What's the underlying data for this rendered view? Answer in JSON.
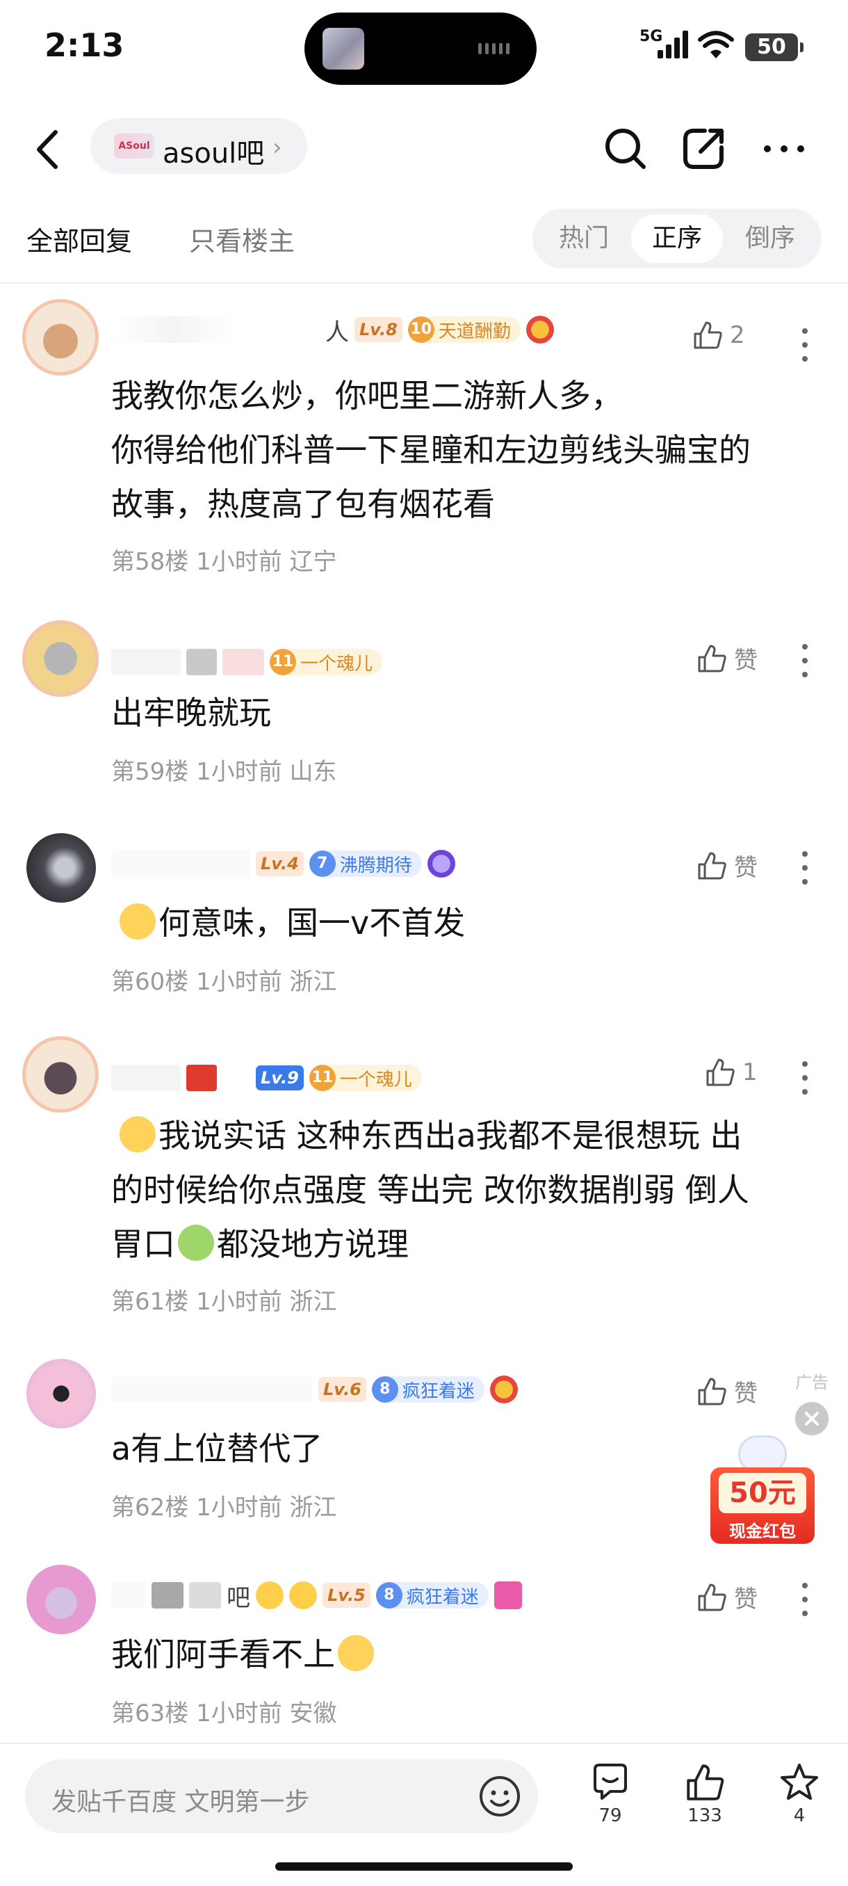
{
  "status_bar": {
    "time": "2:13",
    "network": "5G",
    "battery": "50"
  },
  "navbar": {
    "forum_logo_text": "ASoul",
    "forum_name": "asoul吧"
  },
  "tabs": {
    "all": "全部回复",
    "owner_only": "只看楼主"
  },
  "sort": {
    "hot": "热门",
    "asc": "正序",
    "desc": "倒序",
    "selected": "正序"
  },
  "posts": [
    {
      "name_fragment": "人",
      "level": "Lv.8",
      "badge_num": "10",
      "badge_text": "天道酬勤",
      "likes": "2",
      "content": [
        "我教你怎么炒，你吧里二游新人多，",
        "你得给他们科普一下星瞳和左边剪线头骗宝的",
        "故事，热度高了包有烟花看"
      ],
      "meta": "第58楼 1小时前 辽宁"
    },
    {
      "badge_num": "11",
      "badge_text": "一个魂儿",
      "likes": "赞",
      "content": [
        "出牢晚就玩"
      ],
      "meta": "第59楼 1小时前 山东"
    },
    {
      "level": "Lv.4",
      "badge_num": "7",
      "badge_text": "沸腾期待",
      "likes": "赞",
      "content": [
        "何意味，国一v不首发"
      ],
      "meta": "第60楼 1小时前 浙江"
    },
    {
      "level": "Lv.9",
      "badge_num": "11",
      "badge_text": "一个魂儿",
      "likes": "1",
      "content_line1": "我说实话 这种东西出a我都不是很想玩 出",
      "content_line2": "的时候给你点强度 等出完 改你数据削弱 倒人",
      "content_line3a": "胃口",
      "content_line3b": "都没地方说理",
      "meta": "第61楼 1小时前 浙江"
    },
    {
      "level": "Lv.6",
      "badge_num": "8",
      "badge_text": "疯狂着迷",
      "likes": "赞",
      "content": [
        "a有上位替代了"
      ],
      "meta": "第62楼 1小时前 浙江"
    },
    {
      "name_fragment": "吧",
      "level": "Lv.5",
      "badge_num": "8",
      "badge_text": "疯狂着迷",
      "likes": "赞",
      "content": [
        "我们阿手看不上"
      ],
      "meta": "第63楼 1小时前 安徽"
    }
  ],
  "ad": {
    "label": "广告",
    "amount": "50元",
    "caption": "现金红包"
  },
  "bottom_bar": {
    "placeholder": "发贴千百度 文明第一步",
    "comments": "79",
    "likes": "133",
    "favorites": "4"
  },
  "colors": {
    "level_orange": "#c8731f",
    "level_blue": "#3b7be8",
    "badge_gold": "#f0a23b",
    "badge_blue": "#5b8ff0",
    "text_gray": "#9a9a9a"
  }
}
